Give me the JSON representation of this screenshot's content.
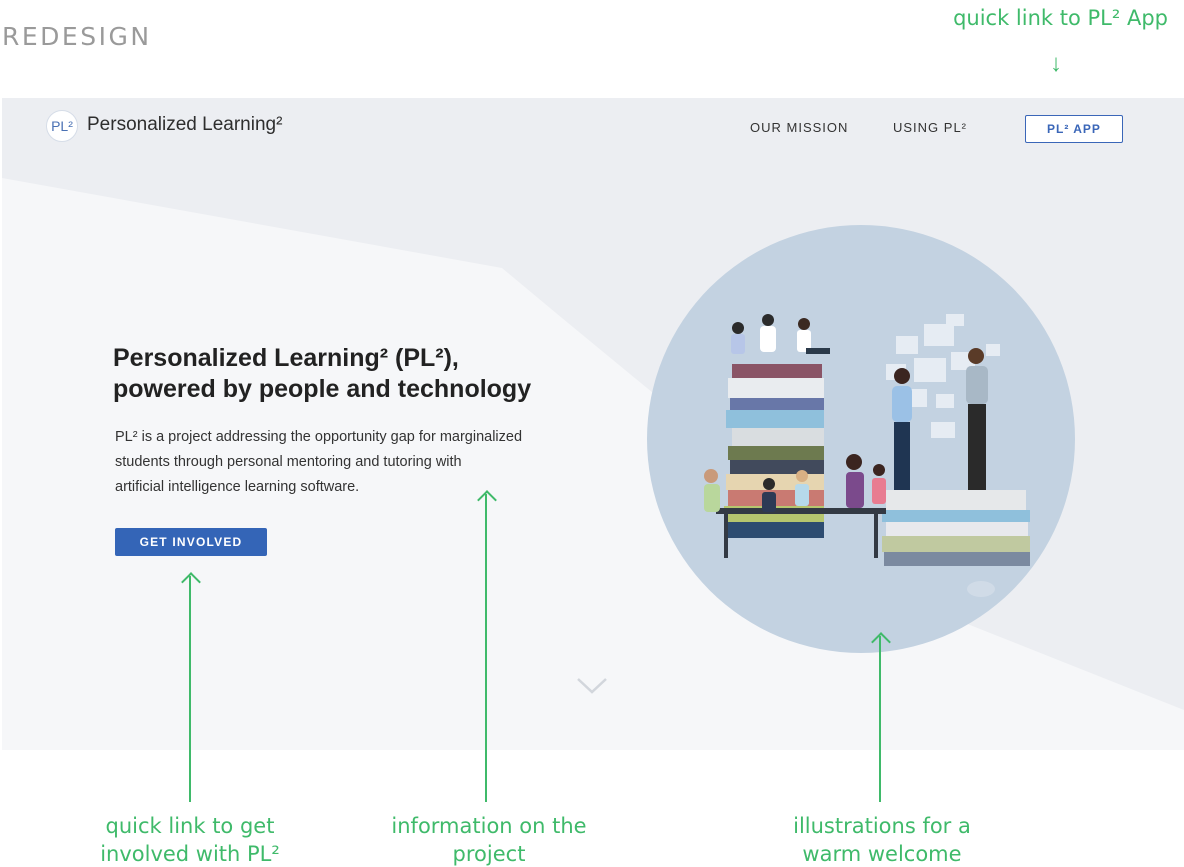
{
  "annotations": {
    "page_label": "REDESIGN",
    "top_right": "quick link to PL² App",
    "cta_note_line1": "quick link to get",
    "cta_note_line2": "involved with PL²",
    "info_note_line1": "information on the",
    "info_note_line2": "project",
    "illustration_note_line1": "illustrations for a",
    "illustration_note_line2": "warm welcome"
  },
  "site": {
    "logo_text": "PL²",
    "brand_name": "Personalized Learning²",
    "nav": {
      "mission": "OUR MISSION",
      "using": "USING PL²",
      "app": "PL² APP"
    },
    "hero": {
      "title_line1": "Personalized Learning² (PL²),",
      "title_line2": "powered by people and technology",
      "desc_line1": "PL² is a project addressing the opportunity gap for marginalized",
      "desc_line2": "students through personal mentoring and tutoring with",
      "desc_line3": "artificial intelligence learning software.",
      "cta": "GET INVOLVED"
    }
  },
  "colors": {
    "annotation": "#3fba6a",
    "primary": "#3465b7",
    "circle": "#c3d2e1"
  },
  "icons": {
    "scroll": "chevron-down-icon",
    "annotation_down": "arrow-down-icon",
    "annotation_up": "arrow-up-icon"
  }
}
